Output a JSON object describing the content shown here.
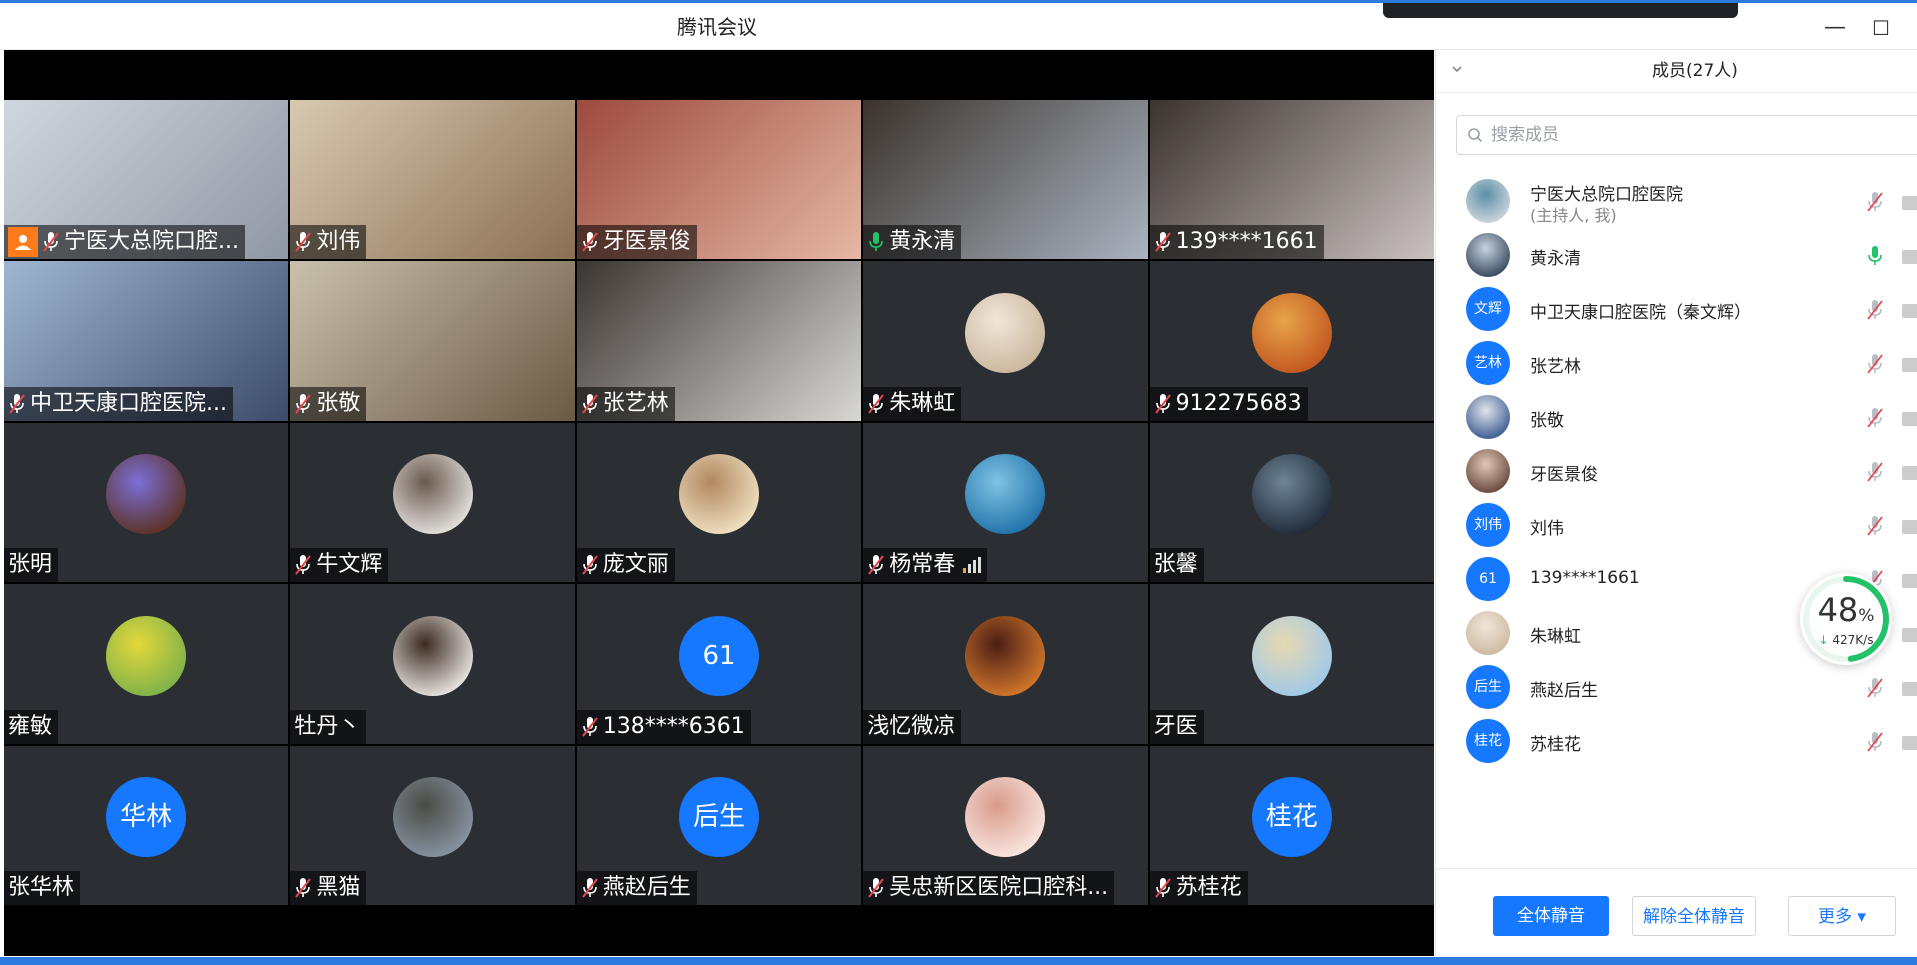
{
  "window": {
    "title": "腾讯会议",
    "minimize_symbol": "—",
    "maximize_symbol": "☐"
  },
  "grid": {
    "tiles": [
      {
        "name": "宁医大总院口腔...",
        "kind": "video",
        "mic": "muted",
        "host": true,
        "colors": [
          "#cfd6de",
          "#8f98a3"
        ]
      },
      {
        "name": "刘伟",
        "kind": "video",
        "mic": "muted",
        "colors": [
          "#d8c9b0",
          "#8a6f55"
        ]
      },
      {
        "name": "牙医景俊",
        "kind": "video",
        "mic": "muted",
        "colors": [
          "#9c4a3c",
          "#e6b8a5"
        ]
      },
      {
        "name": "黄永清",
        "kind": "video",
        "mic": "on",
        "active": true,
        "colors": [
          "#3b332c",
          "#a9b3c0"
        ]
      },
      {
        "name": "139****1661",
        "kind": "video",
        "mic": "muted",
        "colors": [
          "#3a332e",
          "#c9c2c0"
        ]
      },
      {
        "name": "中卫天康口腔医院...",
        "kind": "video",
        "mic": "muted",
        "colors": [
          "#9fb6d3",
          "#3c4b6a"
        ]
      },
      {
        "name": "张敬",
        "kind": "video",
        "mic": "muted",
        "colors": [
          "#c9c0ae",
          "#6b5a45"
        ]
      },
      {
        "name": "张艺林",
        "kind": "video",
        "mic": "muted",
        "colors": [
          "#3b3531",
          "#d9d7d4"
        ]
      },
      {
        "name": "朱琳虹",
        "kind": "avatar",
        "mic": "muted",
        "colors": [
          "#c9b59b",
          "#f0e6da"
        ]
      },
      {
        "name": "912275683",
        "kind": "avatar",
        "mic": "muted",
        "colors": [
          "#c1541e",
          "#e7a44a"
        ]
      },
      {
        "name": "张明",
        "kind": "avatar",
        "mic": "none",
        "colors": [
          "#5a2f1c",
          "#7b6fd8"
        ]
      },
      {
        "name": "牛文辉",
        "kind": "avatar",
        "mic": "muted",
        "colors": [
          "#e8e6e2",
          "#6a5a50"
        ]
      },
      {
        "name": "庞文丽",
        "kind": "avatar",
        "mic": "muted",
        "colors": [
          "#f2e3c4",
          "#b08860"
        ]
      },
      {
        "name": "杨常春",
        "kind": "avatar",
        "mic": "muted",
        "signal": true,
        "colors": [
          "#1e6fa8",
          "#7fc3e4"
        ]
      },
      {
        "name": "张馨",
        "kind": "avatar",
        "mic": "none",
        "colors": [
          "#1c2735",
          "#6f8598"
        ]
      },
      {
        "name": "雍敏",
        "kind": "avatar",
        "mic": "none",
        "colors": [
          "#7ab04a",
          "#e4d83b"
        ]
      },
      {
        "name": "牡丹丶",
        "kind": "avatar",
        "mic": "none",
        "colors": [
          "#f0ece8",
          "#3b2a22"
        ]
      },
      {
        "name": "138****6361",
        "kind": "text",
        "initials": "61",
        "mic": "muted"
      },
      {
        "name": "浅忆微凉",
        "kind": "avatar",
        "mic": "none",
        "colors": [
          "#d87a2c",
          "#4a1e14"
        ]
      },
      {
        "name": "牙医",
        "kind": "avatar",
        "mic": "none",
        "colors": [
          "#9cc8ec",
          "#e8d9b0"
        ]
      },
      {
        "name": "张华林",
        "kind": "text",
        "initials": "华林",
        "mic": "none"
      },
      {
        "name": "黑猫",
        "kind": "avatar",
        "mic": "muted",
        "colors": [
          "#8a96a6",
          "#4a4c44"
        ]
      },
      {
        "name": "燕赵后生",
        "kind": "text",
        "initials": "后生",
        "mic": "muted"
      },
      {
        "name": "吴忠新区医院口腔科...",
        "kind": "avatar",
        "mic": "muted",
        "colors": [
          "#fbe9e4",
          "#d89a8a"
        ]
      },
      {
        "name": "苏桂花",
        "kind": "text",
        "initials": "桂花",
        "mic": "muted"
      }
    ]
  },
  "panel": {
    "title": "成员(27人)",
    "search_placeholder": "搜索成员",
    "members": [
      {
        "name": "宁医大总院口腔医院",
        "sub": "(主持人, 我)",
        "avatar": "image",
        "colors": [
          "#d8dde3",
          "#5b8fa6"
        ],
        "mic": "muted"
      },
      {
        "name": "黄永清",
        "avatar": "image",
        "colors": [
          "#2a3c52",
          "#c7d3e0"
        ],
        "mic": "on"
      },
      {
        "name": "中卫天康口腔医院（秦文辉）",
        "avatar": "text",
        "initials": "文辉",
        "mic": "muted"
      },
      {
        "name": "张艺林",
        "avatar": "text",
        "initials": "艺林",
        "mic": "muted"
      },
      {
        "name": "张敬",
        "avatar": "image",
        "colors": [
          "#2d4f8a",
          "#e1e5ea"
        ],
        "mic": "muted"
      },
      {
        "name": "牙医景俊",
        "avatar": "image",
        "colors": [
          "#5b3c30",
          "#e1c8b8"
        ],
        "mic": "muted"
      },
      {
        "name": "刘伟",
        "avatar": "text",
        "initials": "刘伟",
        "mic": "muted"
      },
      {
        "name": "139****1661",
        "avatar": "text",
        "initials": "61",
        "mic": "muted"
      },
      {
        "name": "朱琳虹",
        "avatar": "image",
        "colors": [
          "#c9b59b",
          "#f0e6da"
        ],
        "mic": "muted"
      },
      {
        "name": "燕赵后生",
        "avatar": "text",
        "initials": "后生",
        "mic": "muted"
      },
      {
        "name": "苏桂花",
        "avatar": "text",
        "initials": "桂花",
        "mic": "muted"
      }
    ],
    "buttons": {
      "mute_all": "全体静音",
      "unmute_all": "解除全体静音",
      "more": "更多 ▾"
    }
  },
  "network_widget": {
    "percent": "48",
    "percent_unit": "%",
    "speed": "427K/s",
    "progress": 0.48
  },
  "colors": {
    "accent": "#1677ff",
    "mic_on": "#23c268",
    "mic_muted": "#e5484d",
    "host_badge": "#ff7a1a"
  }
}
